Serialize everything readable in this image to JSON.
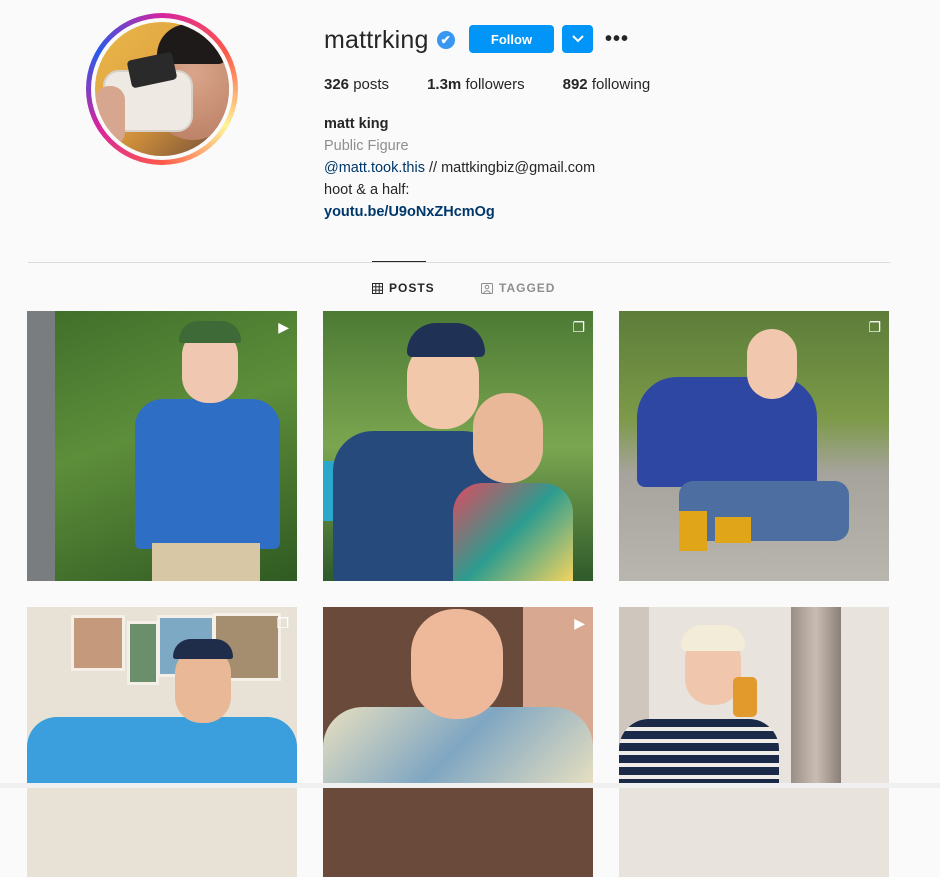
{
  "profile": {
    "username": "mattrking",
    "verified_icon": "✔",
    "follow_label": "Follow",
    "dropdown_icon": "chevron-down-icon",
    "more_label": "•••"
  },
  "stats": {
    "posts_count": "326",
    "posts_label": "posts",
    "followers_count": "1.3m",
    "followers_label": "followers",
    "following_count": "892",
    "following_label": "following"
  },
  "bio": {
    "name": "matt king",
    "category": "Public Figure",
    "mention": "@matt.took.this",
    "mention_suffix": " // mattkingbiz@gmail.com",
    "line3": "hoot & a half:",
    "link": "youtu.be/U9oNxZHcmOg"
  },
  "tabs": {
    "posts": "POSTS",
    "tagged": "TAGGED"
  },
  "posts": [
    {
      "badge": "▶"
    },
    {
      "badge": "❐"
    },
    {
      "badge": "❐"
    },
    {
      "badge": "❐"
    },
    {
      "badge": "▶"
    },
    {
      "badge": ""
    }
  ],
  "colors": {
    "accent": "#0095f6",
    "link": "#00376b",
    "muted": "#8e8e8e"
  }
}
